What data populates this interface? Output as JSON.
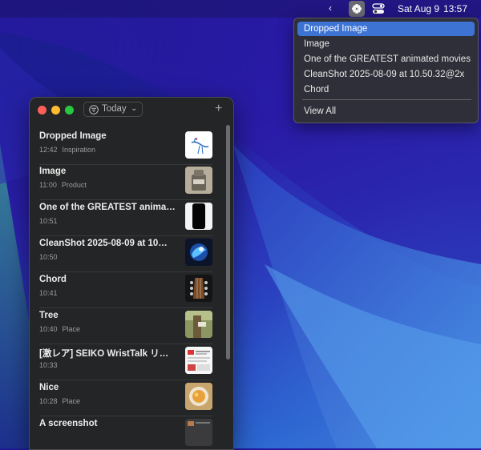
{
  "menubar": {
    "chevron": "‹",
    "app_icon": "clipboard-flower-icon",
    "control_center_icon": "control-center-icon",
    "date": "Sat Aug 9",
    "time": "13:57"
  },
  "dropdown": {
    "items": [
      {
        "label": "Dropped Image",
        "selected": true
      },
      {
        "label": "Image",
        "selected": false
      },
      {
        "label": "One of the GREATEST animated movies",
        "selected": false
      },
      {
        "label": "CleanShot 2025-08-09 at 10.50.32@2x",
        "selected": false
      },
      {
        "label": "Chord",
        "selected": false
      }
    ],
    "view_all": "View All"
  },
  "panel": {
    "filter_label": "Today",
    "filter_icon": "filter-icon",
    "add_label": "+",
    "items": [
      {
        "title": "Dropped Image",
        "time": "12:42",
        "tag": "Inspiration",
        "thumb": "bird-sketch"
      },
      {
        "title": "Image",
        "time": "11:00",
        "tag": "Product",
        "thumb": "product-photo"
      },
      {
        "title": "One of the GREATEST animat…",
        "time": "10:51",
        "tag": "",
        "thumb": "phone-black"
      },
      {
        "title": "CleanShot 2025-08-09 at 10…",
        "time": "10:50",
        "tag": "",
        "thumb": "blue-art"
      },
      {
        "title": "Chord",
        "time": "10:41",
        "tag": "",
        "thumb": "guitar-headstock"
      },
      {
        "title": "Tree",
        "time": "10:40",
        "tag": "Place",
        "thumb": "tree-photo"
      },
      {
        "title": "[激レア] SEIKO WristTalk リス…",
        "time": "10:33",
        "tag": "",
        "thumb": "webpage"
      },
      {
        "title": "Nice",
        "time": "10:28",
        "tag": "Place",
        "thumb": "food-photo"
      },
      {
        "title": "A screenshot",
        "time": "",
        "tag": "",
        "thumb": "screenshot"
      }
    ]
  }
}
